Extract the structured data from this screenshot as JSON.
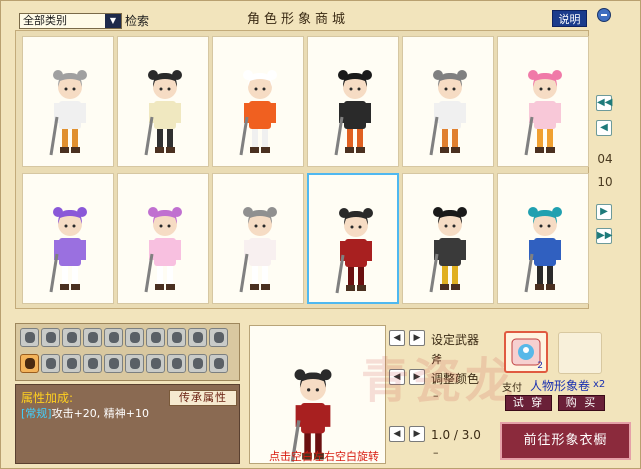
{
  "window": {
    "title": "角色形象商城",
    "help_label": "说明"
  },
  "filter": {
    "category_value": "全部类别",
    "search_label": "检索"
  },
  "paging": {
    "current": "04",
    "total": "10"
  },
  "costumes": [
    {
      "hair": "#a0a0a0",
      "top": "#f0f0f0",
      "bottom": "#e09030"
    },
    {
      "hair": "#2a2a2a",
      "top": "#f0e8c0",
      "bottom": "#303030"
    },
    {
      "hair": "#ffffff",
      "top": "#f06020",
      "bottom": "#f0f0f0"
    },
    {
      "hair": "#1a1a1a",
      "top": "#2a2a2a",
      "bottom": "#e06020"
    },
    {
      "hair": "#808080",
      "top": "#f0f0f0",
      "bottom": "#e08030"
    },
    {
      "hair": "#f07aa8",
      "top": "#f8c8d8",
      "bottom": "#f0a030"
    },
    {
      "hair": "#8a58d8",
      "top": "#9a70e0",
      "bottom": "#ffffff"
    },
    {
      "hair": "#c070d0",
      "top": "#f8c0e0",
      "bottom": "#ffffff"
    },
    {
      "hair": "#909090",
      "top": "#f8f0f0",
      "bottom": "#ffffff"
    },
    {
      "hair": "#2a2a2a",
      "top": "#a82020",
      "bottom": "#6a1010"
    },
    {
      "hair": "#1a1a1a",
      "top": "#3a3a3a",
      "bottom": "#e0b020"
    },
    {
      "hair": "#20a0b0",
      "top": "#3060c0",
      "bottom": "#2a2a2a"
    }
  ],
  "attributes": {
    "heading": "属性加成:",
    "inherit_button": "传承属性",
    "tag": "[常规]",
    "text": "攻击+20, 精神+10"
  },
  "preview": {
    "hint": "点击空白左右空白旋转",
    "avatar": {
      "hair": "#2a2a2a",
      "top": "#a82020",
      "bottom": "#6a1010"
    }
  },
  "controls": {
    "weapon_label": "设定武器",
    "weapon_value": "斧",
    "color_label": "调整颜色",
    "color_value": "–",
    "zoom_value": "1.0 / 3.0",
    "zoom_sub": "–"
  },
  "purchase": {
    "pay_label": "支付",
    "item_name": "人物形象卷",
    "item_count": "x2",
    "slot_qty": "2",
    "try_on_button": "试 穿",
    "buy_button": "购 买",
    "wardrobe_button": "前往形象衣橱",
    "watermark": "青瓷龙"
  }
}
